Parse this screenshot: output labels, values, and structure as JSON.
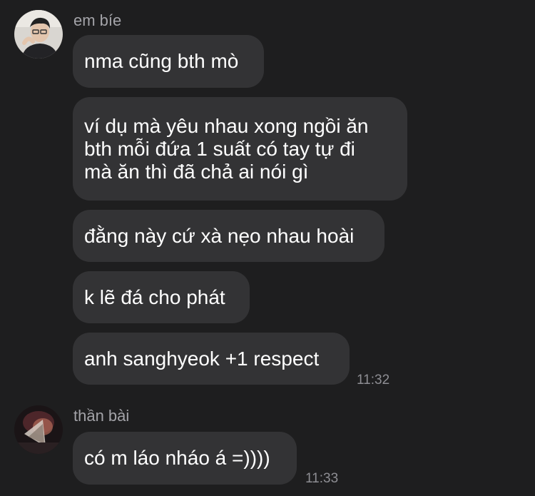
{
  "group1": {
    "sender": "em bíe",
    "messages": [
      "nma cũng bth mò",
      "ví dụ mà yêu nhau xong ngồi ăn\nbth mỗi đứa 1 suất có tay tự đi\nmà ăn thì đã chả ai nói gì",
      "đằng này cứ xà nẹo nhau hoài",
      "k lẽ đá cho phát",
      "anh sanghyeok +1 respect"
    ],
    "time": "11:32"
  },
  "group2": {
    "sender": "thần bài",
    "messages": [
      "có m láo nháo á =))))"
    ],
    "time": "11:33"
  }
}
